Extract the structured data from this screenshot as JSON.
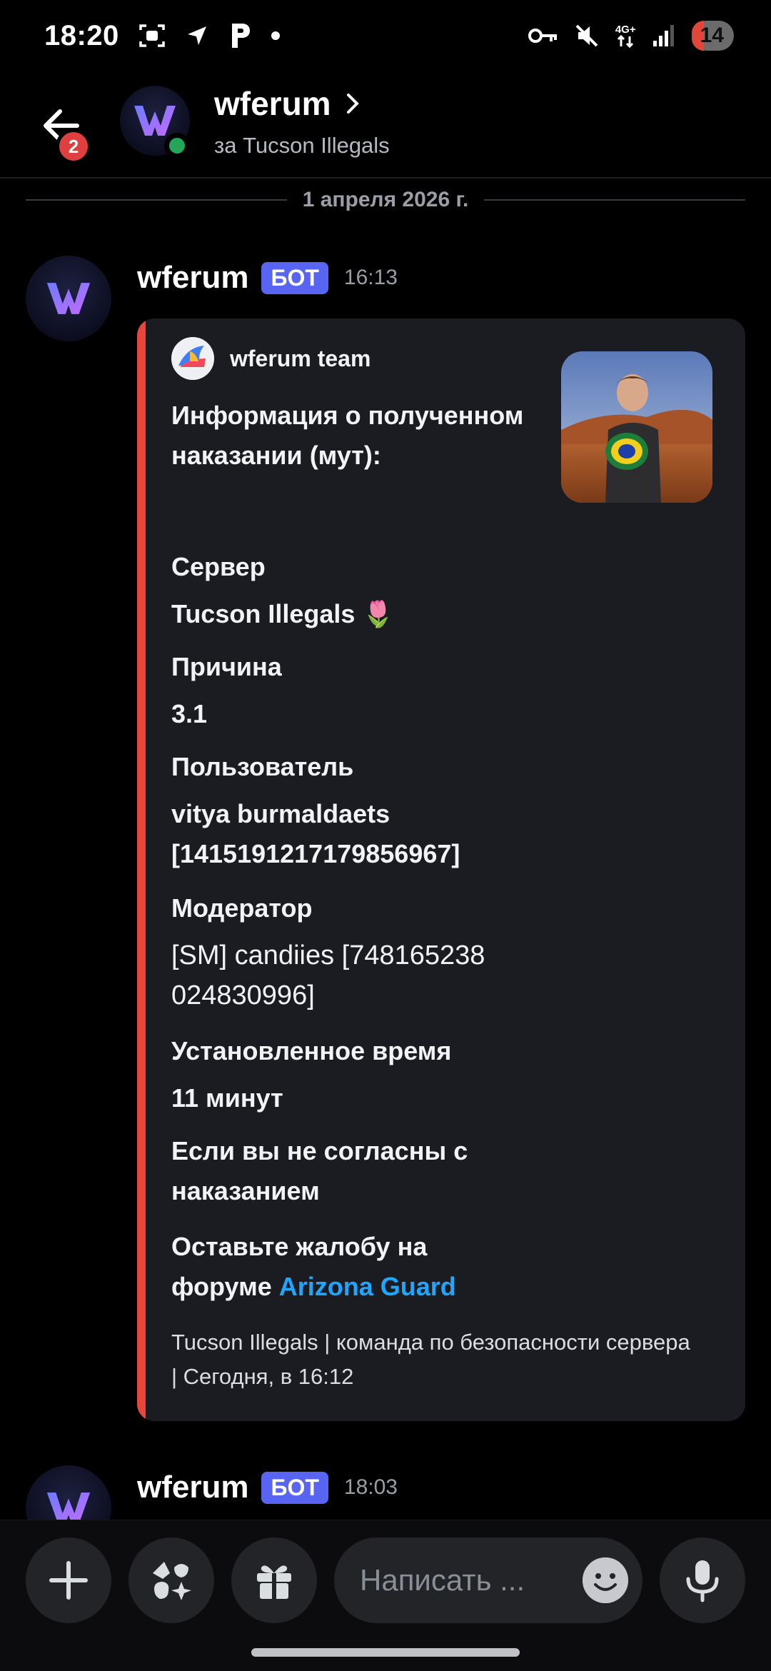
{
  "status_bar": {
    "time": "18:20",
    "network_label": "4G+",
    "battery": "14"
  },
  "header": {
    "back_badge": "2",
    "title": "wferum",
    "subtitle": "за Tucson Illegals"
  },
  "date_divider": "1 апреля 2026 г.",
  "messages": [
    {
      "author": "wferum",
      "tag": "БОТ",
      "time": "16:13",
      "embed": {
        "accent": "#e8453c",
        "author_name": "wferum team",
        "title": "Информация о полученном наказании (мут):",
        "fields": [
          {
            "name": "Сервер",
            "value": "Tucson Illegals 🌷"
          },
          {
            "name": "Причина",
            "value": "3.1"
          },
          {
            "name": "Пользователь",
            "value": "vitya burmaldaets [1415191217179856967]"
          },
          {
            "name": "Модератор",
            "value": "[SM] candiies [748165238024830996]"
          },
          {
            "name": "Установленное время",
            "value": "11 минут"
          },
          {
            "name": "Если вы не согласны с наказанием",
            "value_prefix": "Оставьте жалобу на форуме ",
            "value_link": "Arizona Guard"
          }
        ],
        "footer": "Tucson Illegals | команда по безопасности сервера | Сегодня, в 16:12"
      }
    },
    {
      "author": "wferum",
      "tag": "БОТ",
      "time": "18:03"
    }
  ],
  "input": {
    "placeholder": "Написать ..."
  },
  "icons": {
    "back": "arrow-left-icon",
    "plus": "plus-icon",
    "apps": "apps-icon",
    "gift": "gift-icon",
    "emoji": "emoji-icon",
    "mic": "microphone-icon"
  },
  "colors": {
    "bot_tag": "#5865f2",
    "link": "#1ea7ff",
    "online": "#23a55a"
  }
}
